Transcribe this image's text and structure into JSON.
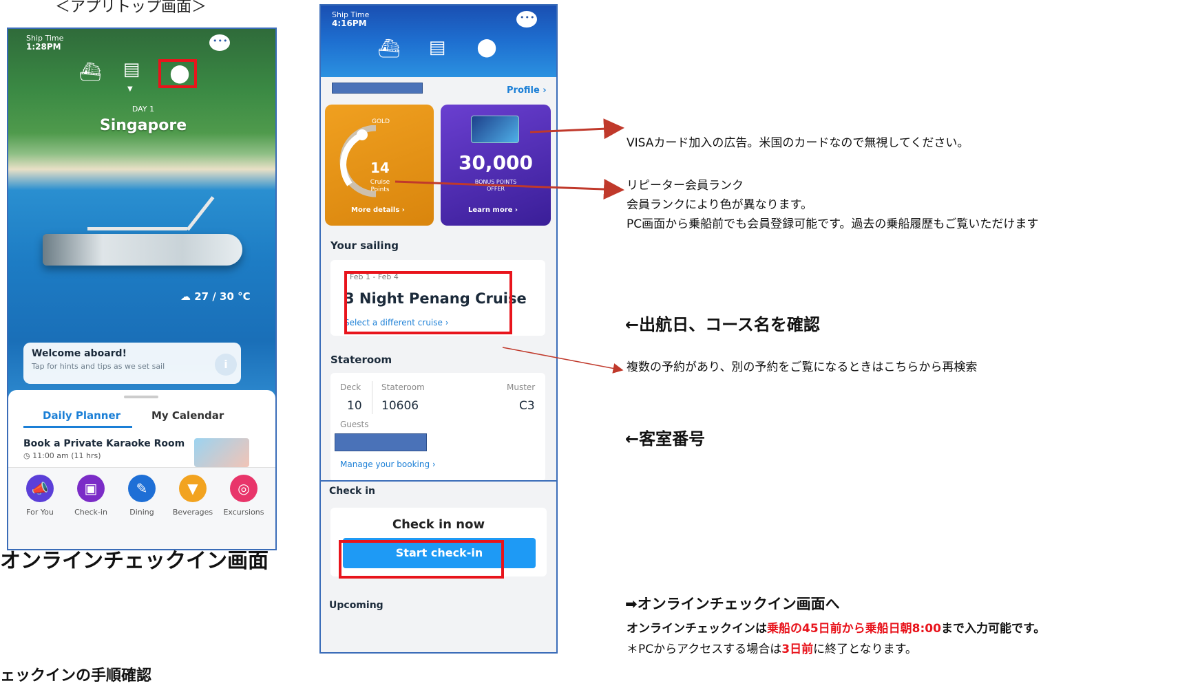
{
  "left": {
    "caption": "＜アプリトップ画面＞",
    "ship_time_label": "Ship Time",
    "ship_time": "1:28PM",
    "day": "DAY 1",
    "city": "Singapore",
    "weather": "27 / 30 °C",
    "welcome_title": "Welcome aboard!",
    "welcome_sub": "Tap for hints and tips as we set sail",
    "tabs": [
      "Daily Planner",
      "My Calendar"
    ],
    "planner_title": "Book a Private Karaoke Room",
    "planner_time": "11:00 am (11 hrs)",
    "bottom_items": [
      {
        "label": "For You",
        "icon": "megaphone-icon",
        "color": "#5b3fd8"
      },
      {
        "label": "Check-in",
        "icon": "passport-icon",
        "color": "#7b2cc7"
      },
      {
        "label": "Dining",
        "icon": "utensils-icon",
        "color": "#1e6fd6"
      },
      {
        "label": "Beverages",
        "icon": "cocktail-icon",
        "color": "#f2a320"
      },
      {
        "label": "Excursions",
        "icon": "snorkel-icon",
        "color": "#e8356a"
      }
    ],
    "heading": "オンラインチェックイン画面",
    "sub_heading": "ェックインの手順確認"
  },
  "right": {
    "ship_time_label": "Ship Time",
    "ship_time": "4:16PM",
    "profile_link": "Profile",
    "gold_tier": "GOLD",
    "cruise_points": "14",
    "cruise_points_label": "Cruise Points",
    "more_details": "More details",
    "bonus_points": "30,000",
    "bonus_label": "BONUS POINTS OFFER",
    "learn_more": "Learn more",
    "your_sailing": "Your sailing",
    "sailing_dates": "Feb 1 - Feb 4",
    "cruise_name": "3 Night Penang Cruise",
    "select_different": "Select a different cruise",
    "stateroom_title": "Stateroom",
    "deck_label": "Deck",
    "deck_value": "10",
    "stateroom_label": "Stateroom",
    "stateroom_value": "10606",
    "muster_label": "Muster",
    "muster_value": "C3",
    "guests_label": "Guests",
    "manage_booking": "Manage your booking",
    "checkin_title": "Check in",
    "checkin_now": "Check in now",
    "start_checkin": "Start check-in",
    "upcoming": "Upcoming"
  },
  "notes": {
    "visa": "VISAカード加入の広告。米国のカードなので無視してください。",
    "rank1": "リピーター会員ランク",
    "rank2": "会員ランクにより色が異なります。",
    "rank3": "PC画面から乗船前でも会員登録可能です。過去の乗船履歴もご覧いただけます",
    "sailing": "←出航日、コース名を確認",
    "multi": "複数の予約があり、別の予約をご覧になるときはこちらから再検索",
    "room": "←客室番号",
    "to_checkin": "➡オンラインチェックイン画面へ",
    "checkin_a": "オンラインチェックインは",
    "checkin_b": "乗船の45日前から乗船日朝8:00",
    "checkin_c": "まで入力可能です。",
    "pc_a": "＊PCからアクセスする場合は",
    "pc_b": "3日前",
    "pc_c": "に終了となります。"
  },
  "colors": {
    "highlight": "#e8141c",
    "accent_blue": "#1b7fd6",
    "frame": "#3a6cb8"
  }
}
